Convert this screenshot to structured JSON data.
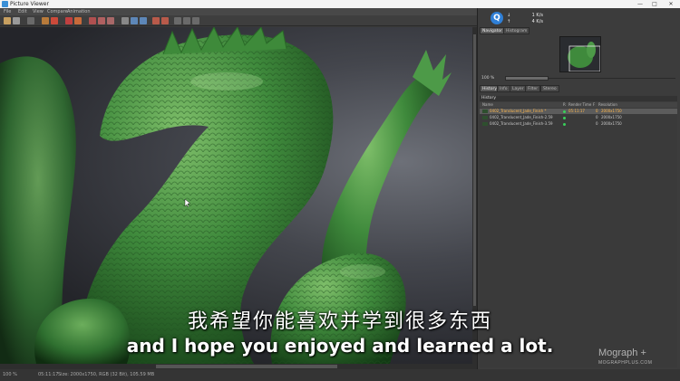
{
  "window": {
    "title": "Picture Viewer",
    "minimize": "—",
    "maximize": "□",
    "close": "✕"
  },
  "menu": [
    "File",
    "Edit",
    "View",
    "Compare",
    "Animation"
  ],
  "speed": {
    "down_label": "↓",
    "down": "1 K/s",
    "up_label": "↑",
    "up": "4 K/s"
  },
  "panel": {
    "tabs": [
      "Navigator",
      "Histogram"
    ],
    "zoom": "100 %",
    "subtabs": [
      "History",
      "Info",
      "Layer",
      "Filter",
      "Stereo"
    ],
    "history_title": "History",
    "columns": [
      "Name",
      "R",
      "Render Time",
      "F",
      "Resolution"
    ],
    "rows": [
      {
        "name": "0402_Translucent_Jade_Finish *",
        "time": "05:11:17",
        "frame": "0",
        "res": "2000x1750",
        "selected": true
      },
      {
        "name": "0402_Translucent_Jade_Finish-2.59",
        "time": "",
        "frame": "0",
        "res": "2000x1750",
        "selected": false
      },
      {
        "name": "0402_Translucent_Jade_Finish-3.59",
        "time": "",
        "frame": "0",
        "res": "2000x1750",
        "selected": false
      }
    ]
  },
  "status": {
    "zoom": "100 %",
    "time": "05:11:17",
    "info": "Size: 2000x1750, RGB (32 Bit), 105.59 MB"
  },
  "subtitles": {
    "cn": "我希望你能喜欢并学到很多东西",
    "en": "and I hope you enjoyed and learned a lot."
  },
  "watermark": {
    "brand": "Mograph +",
    "url": "MOGRAPHPLUS.COM"
  },
  "colors": {
    "accent": "#2f7fd6",
    "selected_text": "#ffb84d",
    "status_ok": "#39d05a",
    "jade": "#3f8a3c"
  }
}
